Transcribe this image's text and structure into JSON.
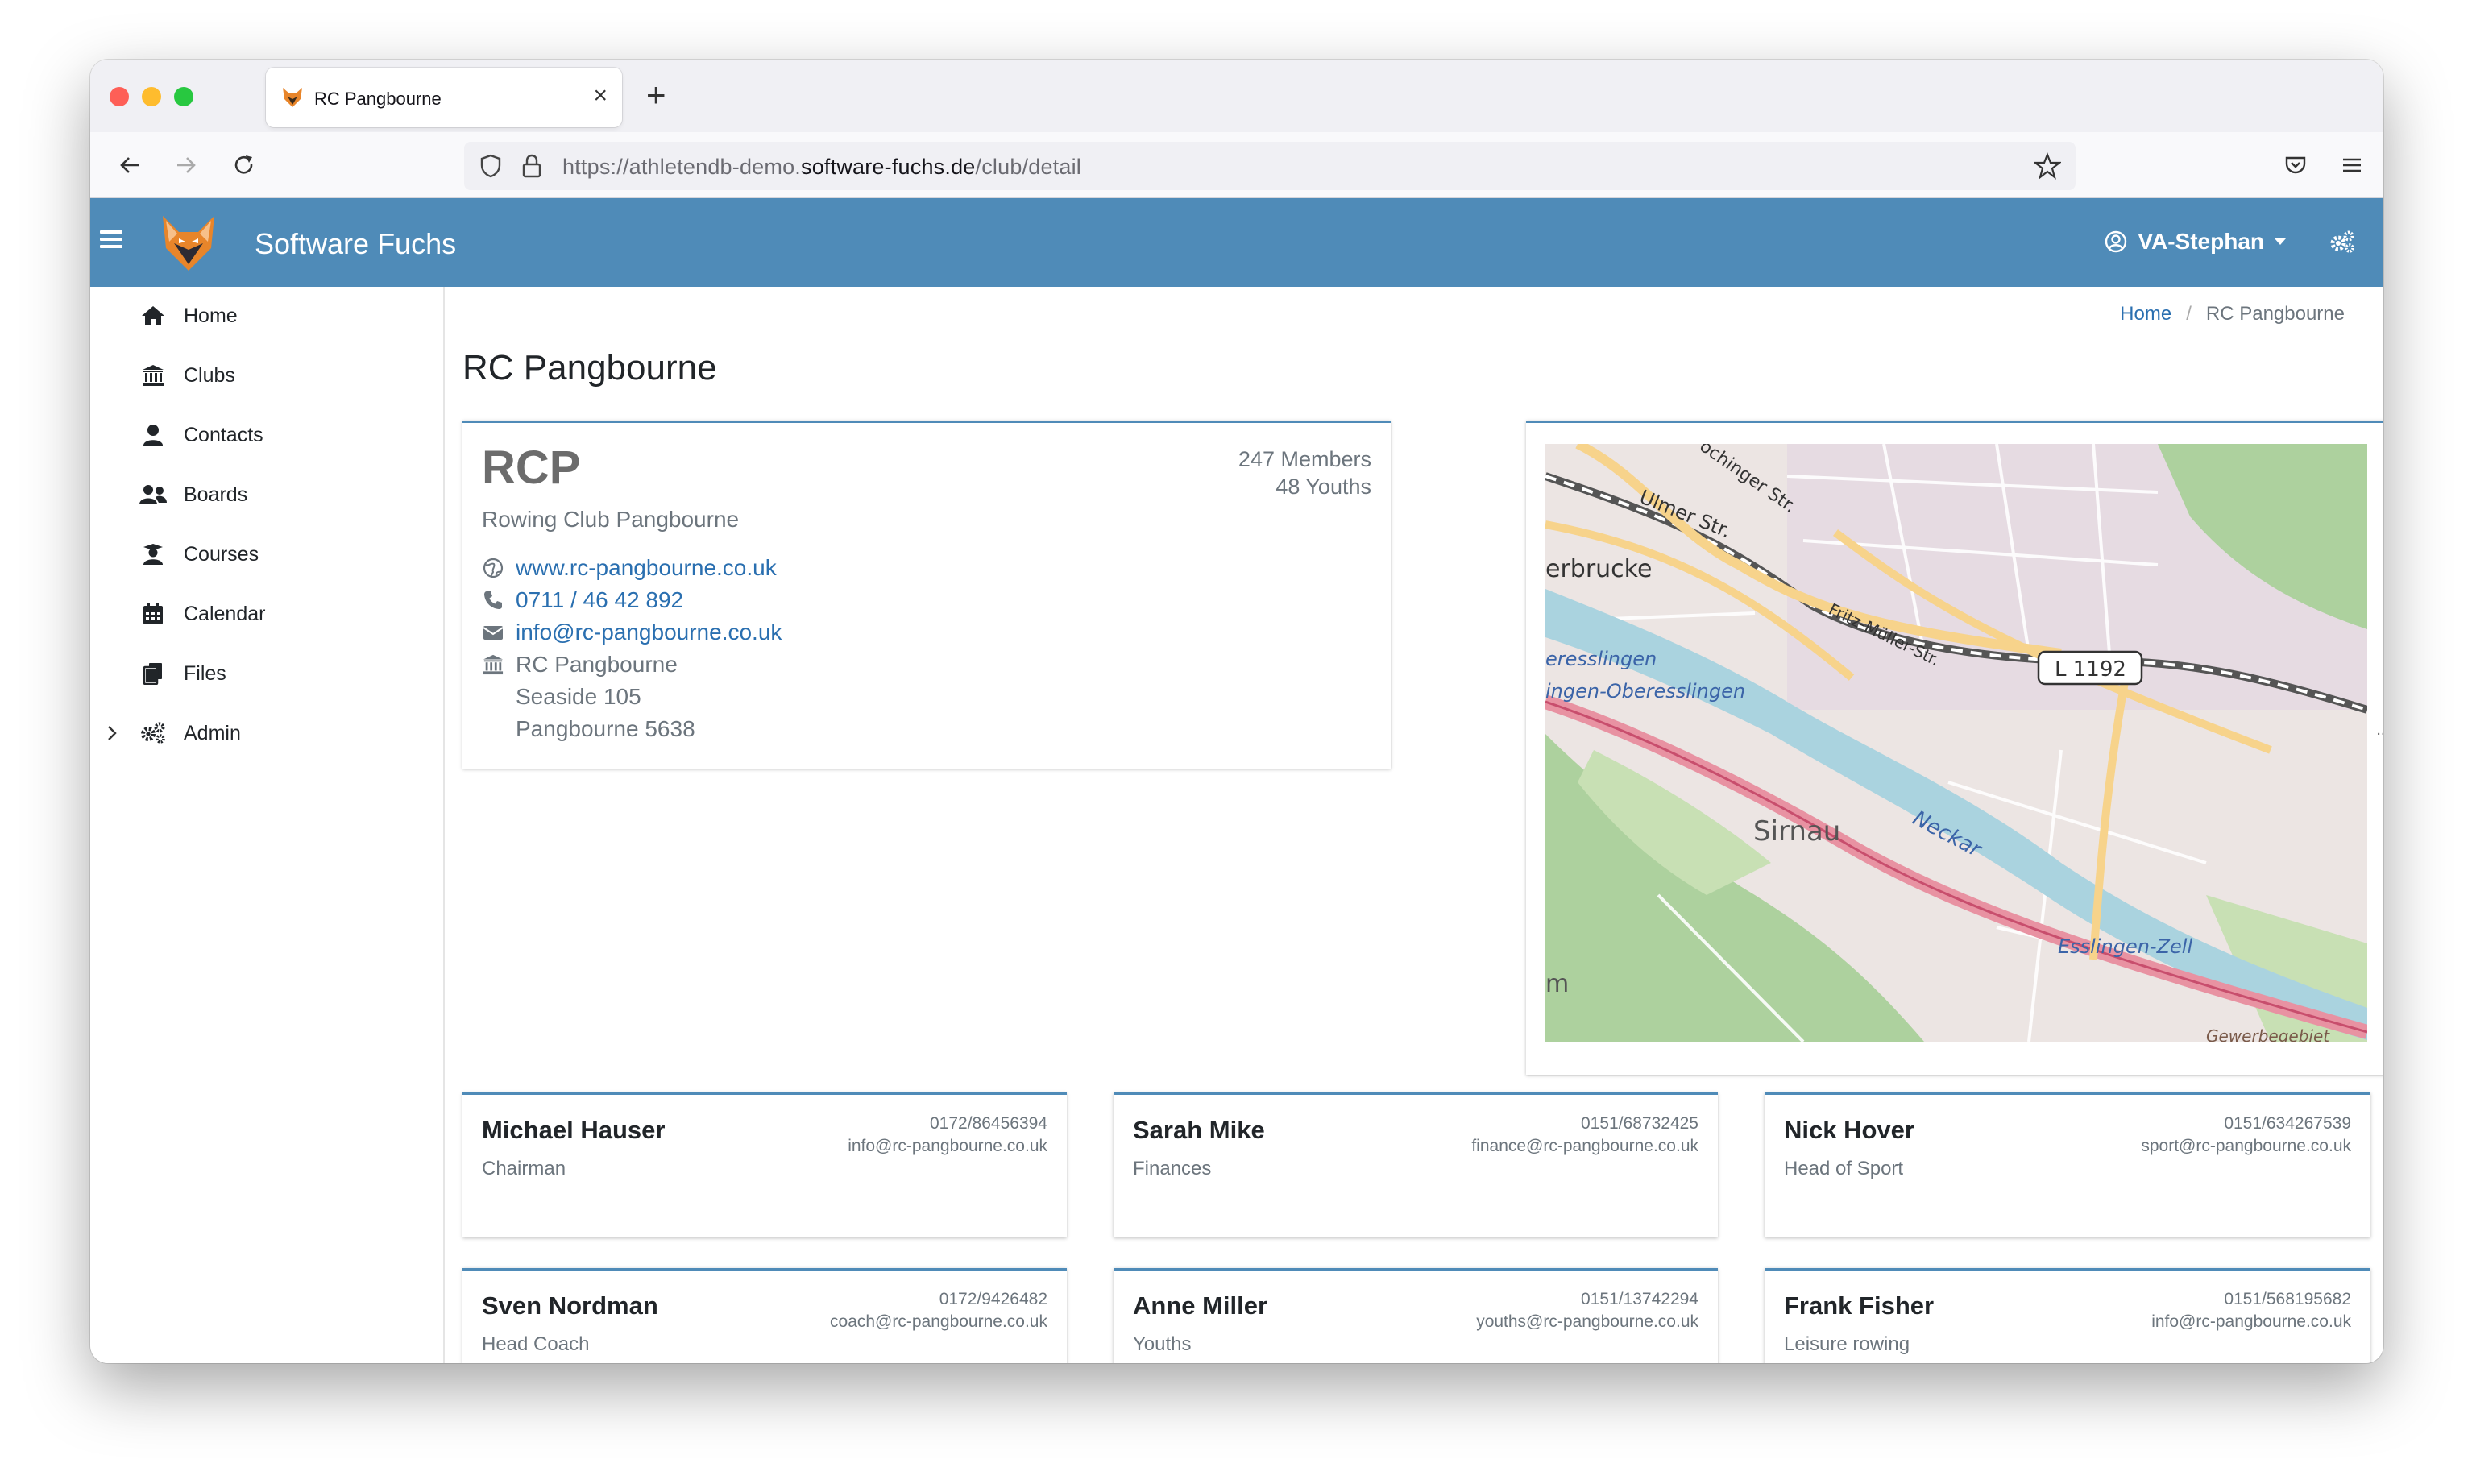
{
  "browser": {
    "tab_title": "RC Pangbourne",
    "url_prefix": "https://athletendb-demo.",
    "url_domain": "software-fuchs.de",
    "url_path": "/club/detail"
  },
  "app": {
    "brand": "Software Fuchs",
    "user": "VA-Stephan",
    "accent_color": "#4f8bb8"
  },
  "sidebar": {
    "items": [
      {
        "label": "Home",
        "icon": "home-icon"
      },
      {
        "label": "Clubs",
        "icon": "landmark-icon"
      },
      {
        "label": "Contacts",
        "icon": "user-icon"
      },
      {
        "label": "Boards",
        "icon": "users-icon"
      },
      {
        "label": "Courses",
        "icon": "graduate-icon"
      },
      {
        "label": "Calendar",
        "icon": "calendar-icon"
      },
      {
        "label": "Files",
        "icon": "files-icon"
      },
      {
        "label": "Admin",
        "icon": "cogs-icon"
      }
    ]
  },
  "breadcrumb": {
    "home": "Home",
    "sep": "/",
    "current": "RC Pangbourne"
  },
  "page": {
    "title": "RC Pangbourne"
  },
  "club": {
    "abbr": "RCP",
    "full_name": "Rowing Club Pangbourne",
    "members": "247 Members",
    "youths": "48 Youths",
    "website": "www.rc-pangbourne.co.uk",
    "phone": "0711 / 46 42 892",
    "email": "info@rc-pangbourne.co.uk",
    "address_name": "RC Pangbourne",
    "street": "Seaside 105",
    "city": "Pangbourne 5638"
  },
  "map": {
    "labels": {
      "ulmer": "Ulmer Str.",
      "ochinger": "ochinger Str.",
      "erbrucke": "erbrucke",
      "fritz": "Fritz-Müller-Str.",
      "road": "L 1192",
      "ober1": "eresslingen",
      "ober2": "ingen-Oberesslingen",
      "sirnau": "Sirnau",
      "neckar": "Neckar",
      "zell": "Esslingen-Zell",
      "gewerbe": "Gewerbegebiet",
      "m": "m"
    },
    "ellipsis": "..."
  },
  "contacts": [
    {
      "name": "Michael Hauser",
      "role": "Chairman",
      "phone": "0172/86456394",
      "email": "info@rc-pangbourne.co.uk"
    },
    {
      "name": "Sarah Mike",
      "role": "Finances",
      "phone": "0151/68732425",
      "email": "finance@rc-pangbourne.co.uk"
    },
    {
      "name": "Nick Hover",
      "role": "Head of Sport",
      "phone": "0151/634267539",
      "email": "sport@rc-pangbourne.co.uk"
    },
    {
      "name": "Sven Nordman",
      "role": "Head Coach",
      "phone": "0172/9426482",
      "email": "coach@rc-pangbourne.co.uk"
    },
    {
      "name": "Anne Miller",
      "role": "Youths",
      "phone": "0151/13742294",
      "email": "youths@rc-pangbourne.co.uk"
    },
    {
      "name": "Frank Fisher",
      "role": "Leisure rowing",
      "phone": "0151/568195682",
      "email": "info@rc-pangbourne.co.uk"
    }
  ]
}
